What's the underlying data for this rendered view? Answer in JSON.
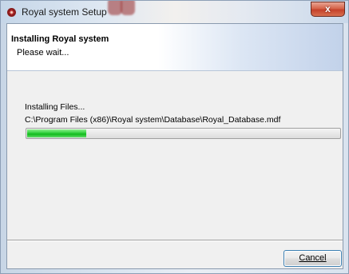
{
  "window": {
    "title": "Royal system Setup",
    "close_glyph": "x"
  },
  "icons": {
    "app": "royal-app-icon",
    "close": "close-icon"
  },
  "header": {
    "title": "Installing Royal system",
    "subtitle": "Please wait..."
  },
  "install": {
    "status": "Installing Files...",
    "current_file": "C:\\Program Files (x86)\\Royal system\\Database\\Royal_Database.mdf",
    "progress_fraction": 0.19
  },
  "buttons": {
    "cancel": "Cancel"
  },
  "colors": {
    "progress_fill": "#13b91d",
    "close_button": "#c4412a",
    "accent_border": "#3c7fb1"
  }
}
